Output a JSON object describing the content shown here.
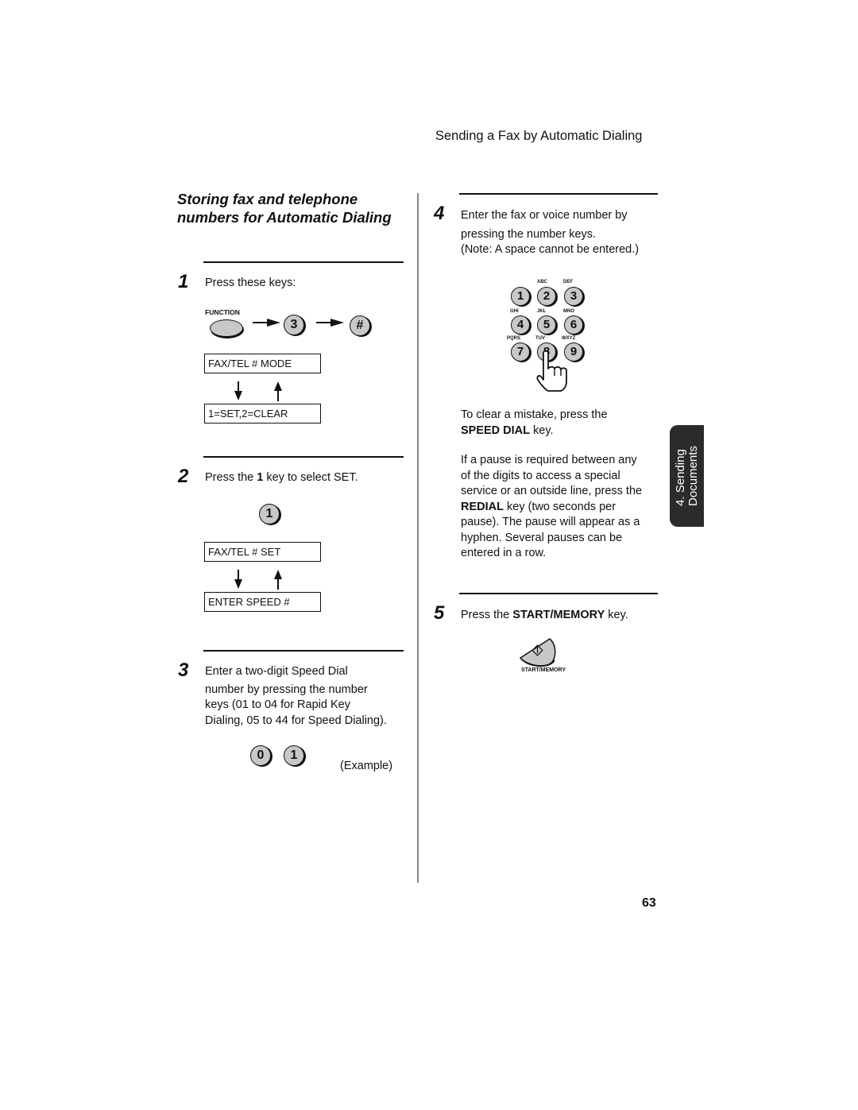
{
  "header": {
    "running_title": "Sending a Fax by Automatic Dialing"
  },
  "section": {
    "title": "Storing fax and telephone numbers for Automatic Dialing"
  },
  "steps": [
    {
      "number": "1",
      "text": "Press these keys:",
      "keys": {
        "function_label": "FUNCTION",
        "key_3": "3",
        "key_hash": "#"
      },
      "lcd": [
        "FAX/TEL # MODE",
        "1=SET,2=CLEAR"
      ]
    },
    {
      "number": "2",
      "text_pre": "Press the ",
      "text_bold": "1",
      "text_post": " key to select SET.",
      "key": "1",
      "lcd": [
        "FAX/TEL # SET",
        "ENTER SPEED #"
      ]
    },
    {
      "number": "3",
      "lines": [
        "Enter a two-digit Speed Dial",
        "number by pressing the number",
        "keys (01 to 04 for Rapid Key",
        "Dialing, 05 to 44 for Speed Dialing)."
      ],
      "keys": [
        "0",
        "1"
      ],
      "example_label": "(Example)"
    },
    {
      "number": "4",
      "lines": [
        "Enter the fax or voice number by",
        "pressing the number keys.",
        "(Note: A space cannot be entered.)"
      ],
      "keypad": [
        {
          "digit": "1",
          "letters": ""
        },
        {
          "digit": "2",
          "letters": "ABC"
        },
        {
          "digit": "3",
          "letters": "DEF"
        },
        {
          "digit": "4",
          "letters": "GHI"
        },
        {
          "digit": "5",
          "letters": "JKL"
        },
        {
          "digit": "6",
          "letters": "MNO"
        },
        {
          "digit": "7",
          "letters": "PQRS"
        },
        {
          "digit": "8",
          "letters": "TUV"
        },
        {
          "digit": "9",
          "letters": "WXYZ"
        }
      ],
      "clear_pre": "To clear a mistake, press the",
      "clear_bold": "SPEED DIAL",
      "clear_post": " key.",
      "pause_lines": [
        "If a pause is required between any",
        "of the digits to access a special",
        "service or an outside line, press the"
      ],
      "pause_bold": "REDIAL",
      "pause_after_bold": " key (two seconds per",
      "pause_lines_2": [
        "pause). The pause will appear as a",
        "hyphen. Several pauses can be",
        "entered in a row."
      ]
    },
    {
      "number": "5",
      "text_pre": "Press the ",
      "text_bold": "START/MEMORY",
      "text_post": " key.",
      "key_label": "START/MEMORY"
    }
  ],
  "side_tab": {
    "line1": "4. Sending",
    "line2": "Documents"
  },
  "footer": {
    "page_number": "63"
  }
}
